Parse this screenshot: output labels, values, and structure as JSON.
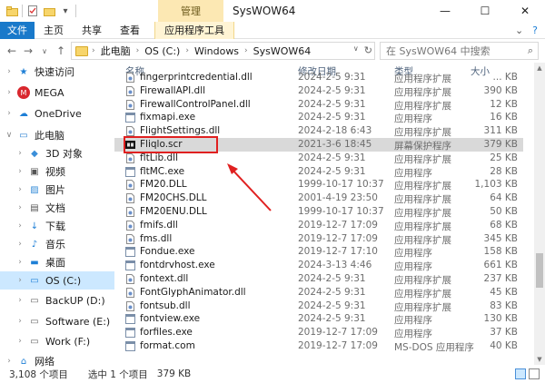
{
  "window": {
    "title": "SysWOW64",
    "context_tab_header": "管理"
  },
  "ribbon_tabs": [
    "文件",
    "主页",
    "共享",
    "查看",
    "应用程序工具"
  ],
  "address": {
    "breadcrumbs": [
      "此电脑",
      "OS (C:)",
      "Windows",
      "SysWOW64"
    ],
    "search_placeholder": "在 SysWOW64 中搜索"
  },
  "nav": [
    {
      "label": "快速访问",
      "icon": "star-icon",
      "color": "#1e7fd6"
    },
    {
      "label": "MEGA",
      "icon": "mega-icon",
      "color": "#d9272e"
    },
    {
      "label": "OneDrive",
      "icon": "cloud-icon",
      "color": "#1e7fd6"
    },
    {
      "label": "此电脑",
      "icon": "computer-icon",
      "color": "#2a7fd0"
    },
    {
      "label": "3D 对象",
      "icon": "cube-icon",
      "color": "#3a8fd9"
    },
    {
      "label": "视频",
      "icon": "video-icon",
      "color": "#555"
    },
    {
      "label": "图片",
      "icon": "picture-icon",
      "color": "#3a8fd9"
    },
    {
      "label": "文档",
      "icon": "document-icon",
      "color": "#555"
    },
    {
      "label": "下载",
      "icon": "download-icon",
      "color": "#1e7fd6"
    },
    {
      "label": "音乐",
      "icon": "music-icon",
      "color": "#1e7fd6"
    },
    {
      "label": "桌面",
      "icon": "desktop-icon",
      "color": "#1e7fd6"
    },
    {
      "label": "OS (C:)",
      "icon": "drive-icon",
      "color": "#1e7fd6"
    },
    {
      "label": "BackUP (D:)",
      "icon": "drive-icon",
      "color": "#666"
    },
    {
      "label": "Software (E:)",
      "icon": "drive-icon",
      "color": "#666"
    },
    {
      "label": "Work (F:)",
      "icon": "drive-icon",
      "color": "#666"
    },
    {
      "label": "网络",
      "icon": "network-icon",
      "color": "#1e7fd6"
    }
  ],
  "columns": {
    "name": "名称",
    "date": "修改日期",
    "type": "类型",
    "size": "大小"
  },
  "files": [
    {
      "name": "fingerprintcredential.dll",
      "date": "2024-2-5 9:31",
      "type": "应用程序扩展",
      "size": "... KB"
    },
    {
      "name": "FirewallAPI.dll",
      "date": "2024-2-5 9:31",
      "type": "应用程序扩展",
      "size": "390 KB"
    },
    {
      "name": "FirewallControlPanel.dll",
      "date": "2024-2-5 9:31",
      "type": "应用程序扩展",
      "size": "12 KB"
    },
    {
      "name": "fixmapi.exe",
      "date": "2024-2-5 9:31",
      "type": "应用程序",
      "size": "16 KB"
    },
    {
      "name": "FlightSettings.dll",
      "date": "2024-2-18 6:43",
      "type": "应用程序扩展",
      "size": "311 KB"
    },
    {
      "name": "Fliqlo.scr",
      "date": "2021-3-6 18:45",
      "type": "屏幕保护程序",
      "size": "379 KB"
    },
    {
      "name": "fltLib.dll",
      "date": "2024-2-5 9:31",
      "type": "应用程序扩展",
      "size": "25 KB"
    },
    {
      "name": "fltMC.exe",
      "date": "2024-2-5 9:31",
      "type": "应用程序",
      "size": "28 KB"
    },
    {
      "name": "FM20.DLL",
      "date": "1999-10-17 10:37",
      "type": "应用程序扩展",
      "size": "1,103 KB"
    },
    {
      "name": "FM20CHS.DLL",
      "date": "2001-4-19 23:50",
      "type": "应用程序扩展",
      "size": "64 KB"
    },
    {
      "name": "FM20ENU.DLL",
      "date": "1999-10-17 10:37",
      "type": "应用程序扩展",
      "size": "50 KB"
    },
    {
      "name": "fmifs.dll",
      "date": "2019-12-7 17:09",
      "type": "应用程序扩展",
      "size": "68 KB"
    },
    {
      "name": "fms.dll",
      "date": "2019-12-7 17:09",
      "type": "应用程序扩展",
      "size": "345 KB"
    },
    {
      "name": "Fondue.exe",
      "date": "2019-12-7 17:10",
      "type": "应用程序",
      "size": "158 KB"
    },
    {
      "name": "fontdrvhost.exe",
      "date": "2024-3-13 4:46",
      "type": "应用程序",
      "size": "661 KB"
    },
    {
      "name": "fontext.dll",
      "date": "2024-2-5 9:31",
      "type": "应用程序扩展",
      "size": "237 KB"
    },
    {
      "name": "FontGlyphAnimator.dll",
      "date": "2024-2-5 9:31",
      "type": "应用程序扩展",
      "size": "45 KB"
    },
    {
      "name": "fontsub.dll",
      "date": "2024-2-5 9:31",
      "type": "应用程序扩展",
      "size": "83 KB"
    },
    {
      "name": "fontview.exe",
      "date": "2024-2-5 9:31",
      "type": "应用程序",
      "size": "130 KB"
    },
    {
      "name": "forfiles.exe",
      "date": "2019-12-7 17:09",
      "type": "应用程序",
      "size": "37 KB"
    },
    {
      "name": "format.com",
      "date": "2019-12-7 17:09",
      "type": "MS-DOS 应用程序",
      "size": "40 KB"
    }
  ],
  "status": {
    "count": "3,108 个项目",
    "selected": "选中 1 个项目",
    "selected_size": "379 KB"
  },
  "colors": {
    "accent": "#1979ca",
    "highlight_red": "#e02020",
    "selection": "#d9d9d9"
  }
}
